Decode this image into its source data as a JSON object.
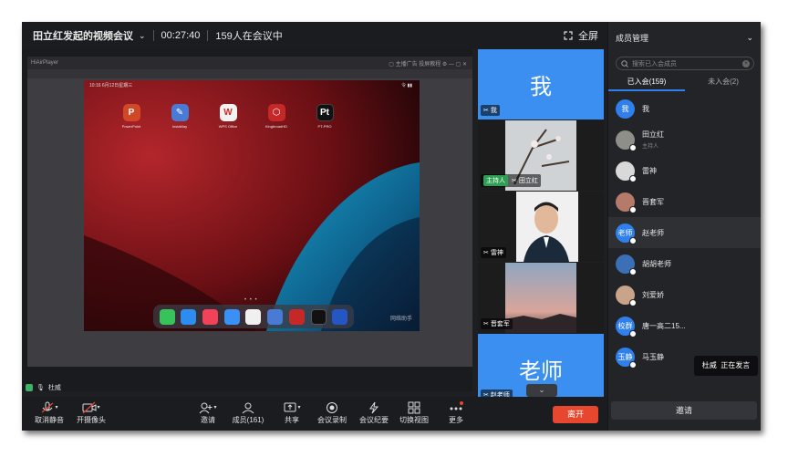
{
  "topbar": {
    "meeting_title": "田立红发起的视频会议",
    "timer": "00:27:40",
    "attendance": "159人在会议中",
    "fullscreen_label": "全屏"
  },
  "player": {
    "title": "HiAirPlayer",
    "controls": "▢ 主播广告   投屏教程   ⚙  —  ▢  ✕",
    "ipad_status_left": "10:16  6月12日星期三",
    "ipad_status_right": "令 ▮▮",
    "apps": [
      "PowerPoint",
      "InstaMay",
      "WPS Office",
      "KingbroadHD",
      "PT-PRO"
    ],
    "watermark": "网络助手"
  },
  "speaker_tag": "杜威",
  "tiles": [
    {
      "big": "我",
      "label": "我",
      "host": ""
    },
    {
      "big": "",
      "label": "田立红",
      "host": "主持人"
    },
    {
      "big": "",
      "label": "雷神",
      "host": ""
    },
    {
      "big": "",
      "label": "晋套军",
      "host": ""
    },
    {
      "big": "老师",
      "label": "赵老师",
      "host": ""
    }
  ],
  "toolbar": {
    "mute": "取消静音",
    "camera": "开摄像头",
    "invite": "邀请",
    "members": "成员(161)",
    "share": "共享",
    "record": "会议录制",
    "minutes": "会议纪要",
    "switch_view": "切换视图",
    "more": "更多",
    "leave": "离开"
  },
  "panel": {
    "title": "成员管理",
    "search_placeholder": "搜索已入会成员",
    "tab_joined": "已入会(159)",
    "tab_not_joined": "未入会(2)",
    "members": [
      {
        "name": "我",
        "sub": "",
        "avatar": "我",
        "color": "#2f80ed"
      },
      {
        "name": "田立红",
        "sub": "主持人",
        "avatar": "",
        "color": "#8d8f88"
      },
      {
        "name": "雷神",
        "sub": "",
        "avatar": "",
        "color": "#d9d9d9"
      },
      {
        "name": "晋套军",
        "sub": "",
        "avatar": "",
        "color": "#b57a6a"
      },
      {
        "name": "赵老师",
        "sub": "",
        "avatar": "老师",
        "color": "#2f80ed"
      },
      {
        "name": "胡胡老师",
        "sub": "",
        "avatar": "",
        "color": "#3b6fb6"
      },
      {
        "name": "刘爱娇",
        "sub": "",
        "avatar": "",
        "color": "#c9a38a"
      },
      {
        "name": "唐一高二15...",
        "sub": "",
        "avatar": "校群",
        "color": "#2f80ed"
      },
      {
        "name": "马玉静",
        "sub": "",
        "avatar": "玉静",
        "color": "#2f80ed"
      }
    ],
    "tooltip_name": "杜威",
    "tooltip_status": "正在发言",
    "invite_button": "邀请"
  },
  "colors": {
    "accent": "#2f80ed",
    "leave": "#e8472f",
    "host_badge": "#2f9e55"
  }
}
